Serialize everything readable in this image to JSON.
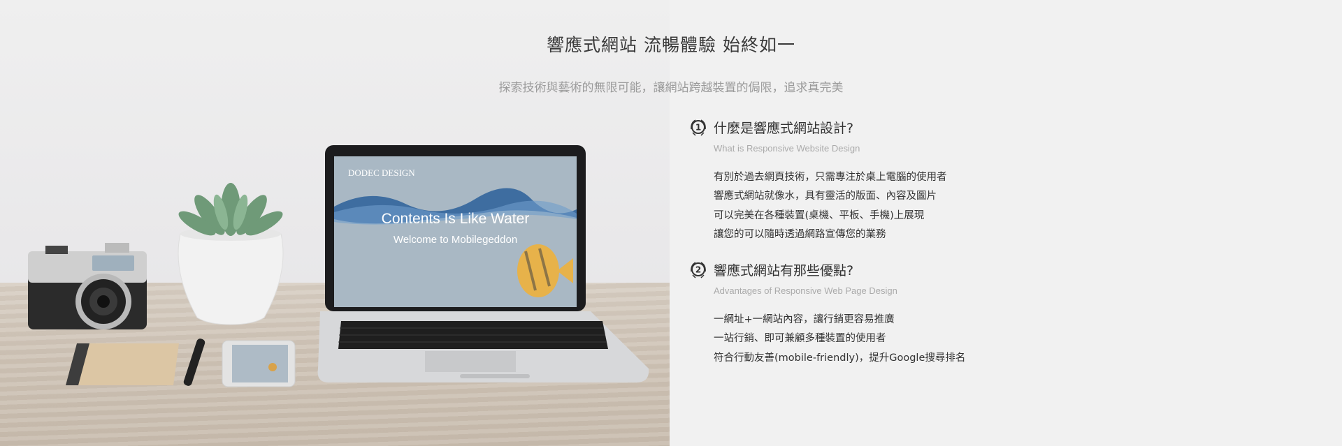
{
  "header": {
    "title": "響應式網站   流暢體驗  始終如一",
    "subtitle": "探索技術與藝術的無限可能，讓網站跨越裝置的侷限，追求真完美"
  },
  "photo": {
    "screen_brand": "DODEC DESIGN",
    "screen_headline": "Contents Is Like Water",
    "screen_tagline": "Welcome to Mobilegeddon"
  },
  "sections": [
    {
      "icon": "number-1-icon",
      "title": "什麼是響應式網站設計?",
      "subtitle": "What is Responsive Website Design",
      "items": [
        "有別於過去網頁技術，只需專注於桌上電腦的使用者",
        "響應式網站就像水，具有靈活的版面、內容及圖片",
        "可以完美在各種裝置(桌機、平板、手機)上展現",
        "讓您的可以隨時透過網路宣傳您的業務"
      ]
    },
    {
      "icon": "number-2-icon",
      "title": "響應式網站有那些優點?",
      "subtitle": "Advantages of Responsive Web Page Design",
      "items": [
        "一網址+一網站內容，讓行銷更容易推廣",
        "一站行銷、即可兼顧多種裝置的使用者",
        "符合行動友善(mobile-friendly)，提升Google搜尋排名"
      ]
    }
  ]
}
